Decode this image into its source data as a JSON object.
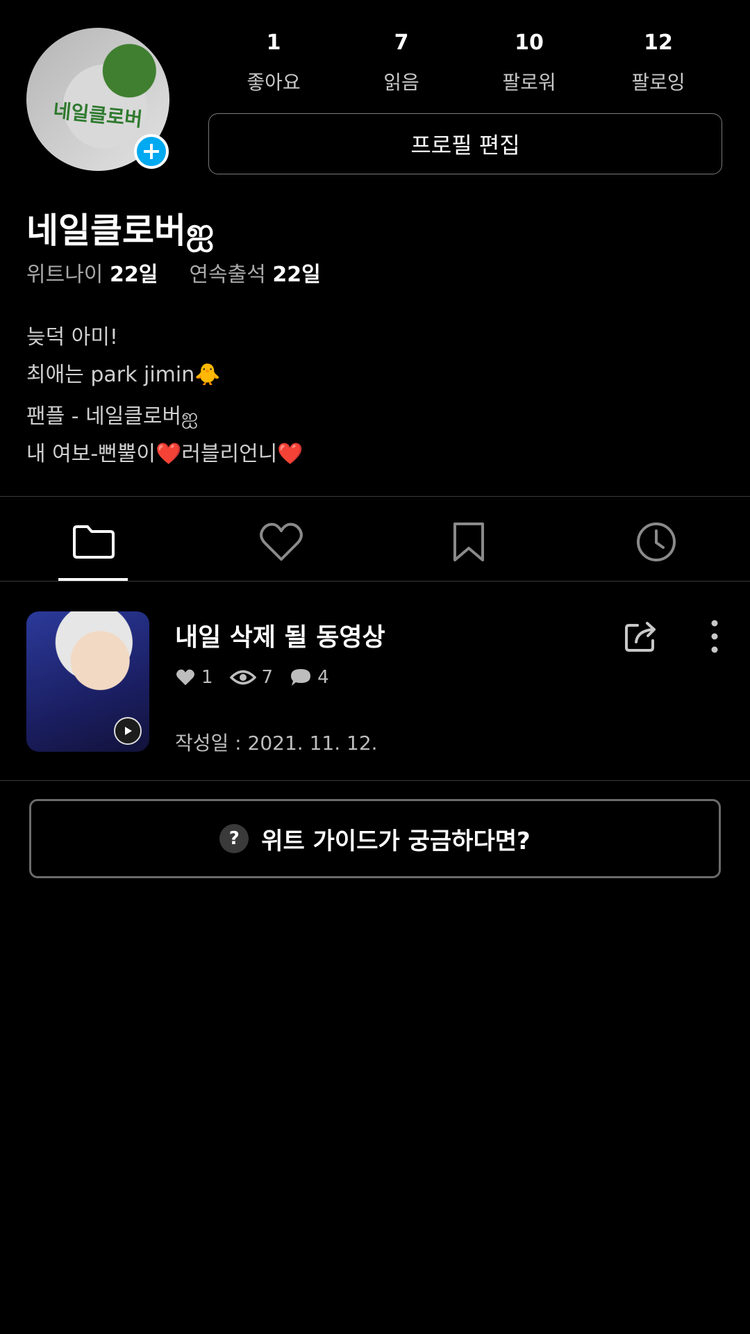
{
  "profile": {
    "avatar_text": "네일클로버",
    "username": "네일클로버ஐ",
    "age_label": "위트나이",
    "age_value": "22일",
    "streak_label": "연속출석",
    "streak_value": "22일",
    "edit_label": "프로필 편집",
    "bio": [
      "늦덕 아미!",
      "최애는 park jimin🐥",
      "팬플 - 네일클로버ஐ",
      "내 여보-뻔뿔이❤️러블리언니❤️"
    ]
  },
  "stats": [
    {
      "value": "1",
      "label": "좋아요"
    },
    {
      "value": "7",
      "label": "읽음"
    },
    {
      "value": "10",
      "label": "팔로워"
    },
    {
      "value": "12",
      "label": "팔로잉"
    }
  ],
  "tabs": [
    {
      "icon": "folder-icon",
      "selected": true
    },
    {
      "icon": "heart-icon",
      "selected": false
    },
    {
      "icon": "bookmark-icon",
      "selected": false
    },
    {
      "icon": "clock-icon",
      "selected": false
    }
  ],
  "posts": [
    {
      "title": "내일 삭제 될 동영상",
      "likes": "1",
      "views": "7",
      "comments": "4",
      "date": "작성일 : 2021. 11. 12.",
      "type": "video"
    }
  ],
  "guide": {
    "icon": "?",
    "label": "위트 가이드가 궁금하다면?"
  },
  "colors": {
    "accent": "#00a9f0",
    "background": "#000000",
    "muted_text": "#bdbdbd"
  }
}
